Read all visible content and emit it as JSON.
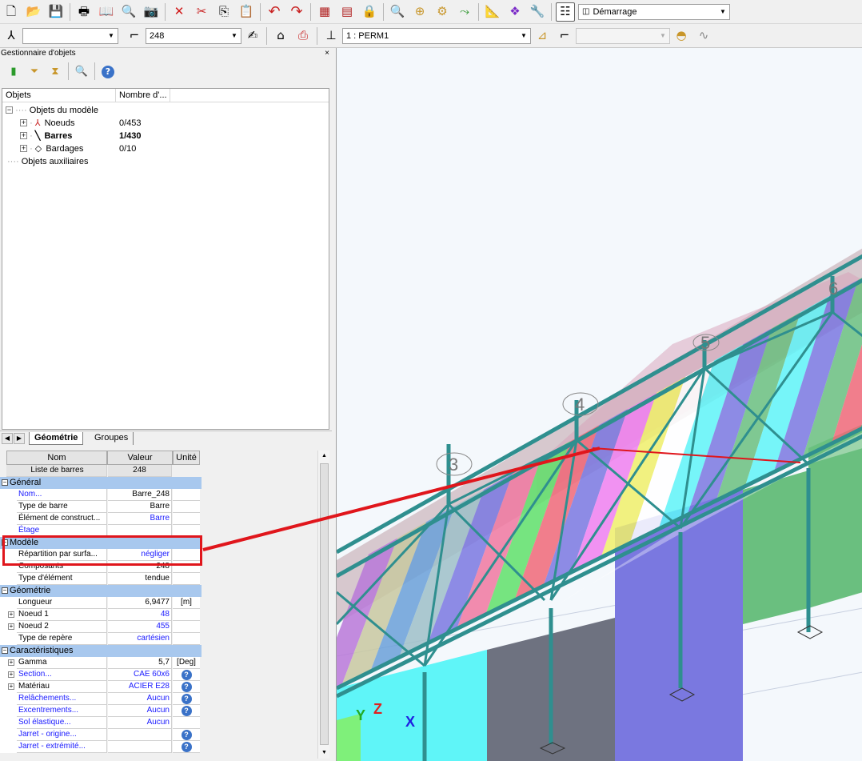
{
  "toolbar_main": {
    "icons": [
      "new-file-icon",
      "open-folder-icon",
      "save-icon",
      "print-icon",
      "print-preview-icon",
      "report-icon",
      "screenshot-icon",
      "delete-icon",
      "cut-icon",
      "copy-icon",
      "paste-icon",
      "undo-icon",
      "redo-icon",
      "calculator-icon",
      "table-icon",
      "lock-icon",
      "zoom-icon",
      "zoom-window-icon",
      "display-attributes-icon",
      "selection-icon",
      "measure-icon",
      "structure-view-icon",
      "tools-icon",
      "layout-icon"
    ],
    "layout_value": "Démarrage"
  },
  "toolbar_selection": {
    "node_select_value": "",
    "bar_select_value": "248",
    "case_select_value": "1 : PERM1",
    "mode_select_value": ""
  },
  "object_manager": {
    "title": "Gestionnaire d'objets",
    "close": "×",
    "col_objects": "Objets",
    "col_count": "Nombre d'...",
    "root_label": "Objets du modèle",
    "items": [
      {
        "label": "Noeuds",
        "count": "0/453",
        "bold": false
      },
      {
        "label": "Barres",
        "count": "1/430",
        "bold": true
      },
      {
        "label": "Bardages",
        "count": "0/10",
        "bold": false
      }
    ],
    "aux_label": "Objets auxiliaires"
  },
  "tabs": {
    "geometry": "Géométrie",
    "groups": "Groupes"
  },
  "properties": {
    "headers": {
      "name": "Nom",
      "value": "Valeur",
      "unit": "Unité"
    },
    "list_row": {
      "name": "Liste de barres",
      "value": "248"
    },
    "sections": [
      {
        "title": "Général",
        "rows": [
          {
            "name": "Nom...",
            "value": "Barre_248",
            "unit": "",
            "link": true,
            "value_blue": false
          },
          {
            "name": "Type de barre",
            "value": "Barre",
            "unit": "",
            "link": false,
            "value_blue": false
          },
          {
            "name": "Élément de construct...",
            "value": "Barre",
            "unit": "",
            "link": false,
            "value_blue": true
          },
          {
            "name": "Étage",
            "value": "",
            "unit": "",
            "link": true,
            "value_blue": false
          }
        ]
      },
      {
        "title": "Modèle",
        "rows": [
          {
            "name": "Répartition par surfa...",
            "value": "négliger",
            "unit": "",
            "link": false,
            "value_blue": true
          },
          {
            "name": "Composants",
            "value": "248",
            "unit": "",
            "link": false,
            "value_blue": false
          },
          {
            "name": "Type d'élément",
            "value": "tendue",
            "unit": "",
            "link": false,
            "value_blue": false
          }
        ]
      },
      {
        "title": "Géométrie",
        "rows": [
          {
            "name": "Longueur",
            "value": "6,9477",
            "unit": "[m]",
            "link": false,
            "value_blue": false
          },
          {
            "name": "Noeud 1",
            "value": "48",
            "unit": "",
            "link": false,
            "value_blue": true,
            "expand": true
          },
          {
            "name": "Noeud 2",
            "value": "455",
            "unit": "",
            "link": false,
            "value_blue": true,
            "expand": true
          },
          {
            "name": "Type de repère",
            "value": "cartésien",
            "unit": "",
            "link": false,
            "value_blue": true
          }
        ]
      },
      {
        "title": "Caractéristiques",
        "rows": [
          {
            "name": "Gamma",
            "value": "5,7",
            "unit": "[Deg]",
            "link": false,
            "value_blue": false,
            "expand": true
          },
          {
            "name": "Section...",
            "value": "CAE 60x6",
            "unit": "?",
            "link": true,
            "value_blue": true,
            "expand": true
          },
          {
            "name": "Matériau",
            "value": "ACIER E28",
            "unit": "?",
            "link": false,
            "value_blue": true,
            "expand": true
          },
          {
            "name": "Relâchements...",
            "value": "Aucun",
            "unit": "?",
            "link": true,
            "value_blue": true
          },
          {
            "name": "Excentrements...",
            "value": "Aucun",
            "unit": "?",
            "link": true,
            "value_blue": true
          },
          {
            "name": "Sol élastique...",
            "value": "Aucun",
            "unit": "",
            "link": true,
            "value_blue": true
          },
          {
            "name": "Jarret - origine...",
            "value": "",
            "unit": "?",
            "link": true,
            "value_blue": false
          },
          {
            "name": "Jarret - extrémité...",
            "value": "",
            "unit": "?",
            "link": true,
            "value_blue": false
          }
        ]
      }
    ]
  },
  "viewport": {
    "axis_labels": [
      "Y",
      "Z",
      "X"
    ],
    "grid_labels": [
      "3",
      "4",
      "5",
      "6"
    ],
    "colors": {
      "beam": "#2f8f8f",
      "wall_cyan": "#5ff5f8",
      "wall_gray": "#6e7280",
      "wall_blue": "#7a78e0",
      "wall_green": "#6abf7f",
      "highlight": "#e0161c"
    }
  }
}
